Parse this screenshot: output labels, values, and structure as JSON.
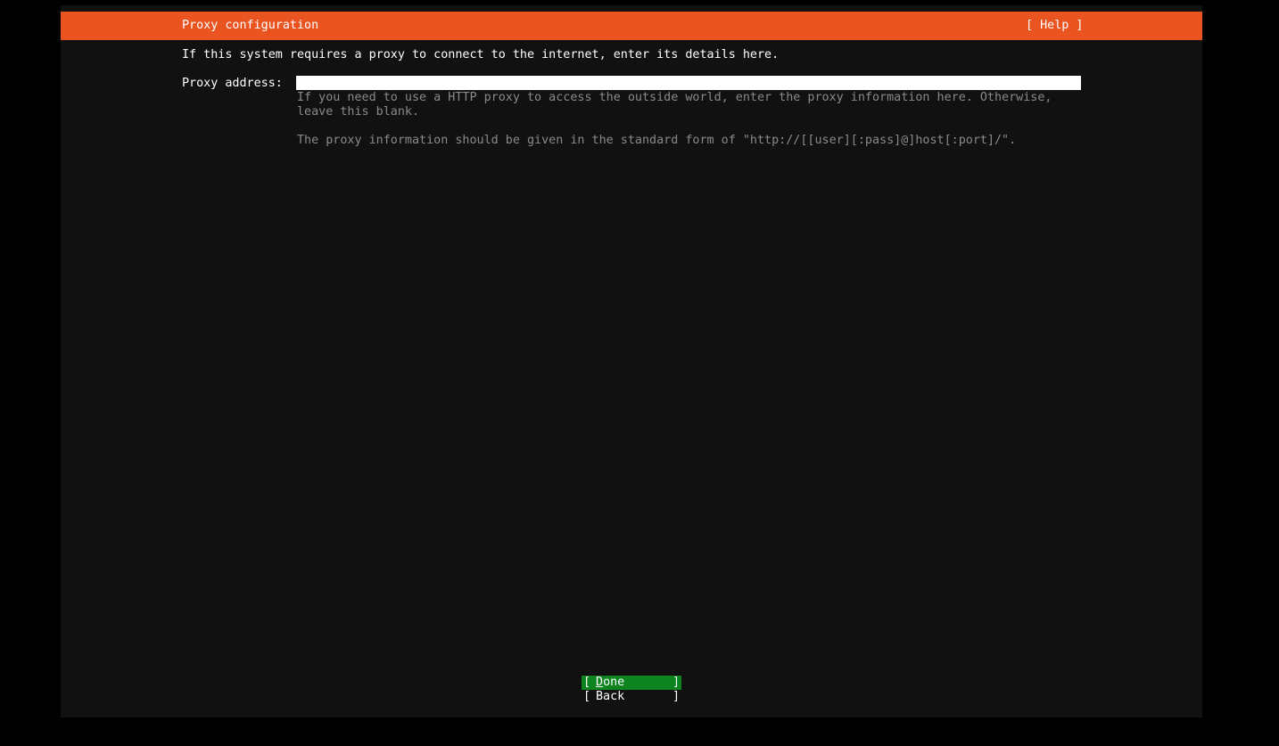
{
  "header": {
    "title": "Proxy configuration",
    "help_label": "[ Help ]"
  },
  "intro": "If this system requires a proxy to connect to the internet, enter its details here.",
  "form": {
    "proxy_label": "Proxy address:",
    "proxy_value": ""
  },
  "help_text": {
    "line1": "If you need to use a HTTP proxy to access the outside world, enter the proxy information here. Otherwise,",
    "line2": "leave this blank.",
    "line3": "The proxy information should be given in the standard form of \"http://[[user][:pass]@]host[:port]/\"."
  },
  "buttons": {
    "done_label": "Done",
    "back_label": "Back",
    "bracket_open": "[",
    "bracket_close": "]"
  },
  "colors": {
    "accent": "#e95420",
    "selected_button": "#0e8420",
    "background": "#111111",
    "help_text": "#8a8a8a"
  }
}
